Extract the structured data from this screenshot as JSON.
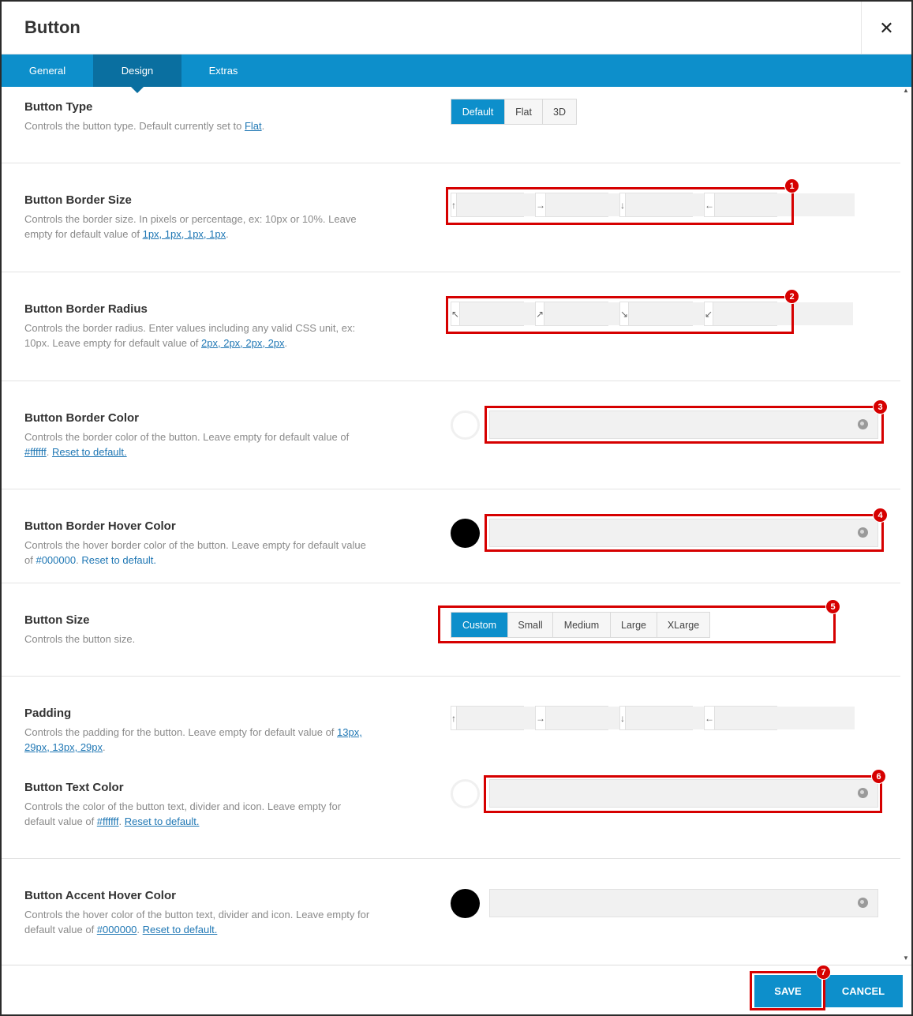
{
  "dialog": {
    "title": "Button"
  },
  "tabs": [
    {
      "label": "General"
    },
    {
      "label": "Design"
    },
    {
      "label": "Extras"
    }
  ],
  "settings": {
    "button_type": {
      "label": "Button Type",
      "desc_text": "Controls the button type. Default currently set to ",
      "desc_link": "Flat",
      "desc_end": ".",
      "options": [
        "Default",
        "Flat",
        "3D"
      ],
      "selected": "Default"
    },
    "border_size": {
      "label": "Button Border Size",
      "desc_text": "Controls the border size. In pixels or percentage, ex: 10px or 10%. Leave empty for default value of ",
      "desc_link": "1px, 1px, 1px, 1px",
      "desc_end": ".",
      "icons": [
        "↑",
        "→",
        "↓",
        "←"
      ]
    },
    "border_radius": {
      "label": "Button Border Radius",
      "desc_text": "Controls the border radius. Enter values including any valid CSS unit, ex: 10px. Leave empty for default value of ",
      "desc_link": "2px, 2px, 2px, 2px",
      "desc_end": ".",
      "icons": [
        "↖",
        "↗",
        "↘",
        "↙"
      ]
    },
    "border_color": {
      "label": "Button Border Color",
      "desc_text": "Controls the border color of the button. Leave empty for default value of ",
      "desc_link": "#ffffff",
      "desc_mid": ". ",
      "reset": "Reset to default.",
      "swatch": "#ffffff"
    },
    "border_hover_color": {
      "label": "Button Border Hover Color",
      "desc_text": "Controls the hover border color of the button. Leave empty for default value of ",
      "desc_link": "#000000",
      "desc_mid": ". ",
      "reset": "Reset to default.",
      "swatch": "#000000"
    },
    "button_size": {
      "label": "Button Size",
      "desc": "Controls the button size.",
      "options": [
        "Custom",
        "Small",
        "Medium",
        "Large",
        "XLarge"
      ],
      "selected": "Custom"
    },
    "padding": {
      "label": "Padding",
      "desc_text": "Controls the padding for the button. Leave empty for default value of ",
      "desc_link": "13px, 29px, 13px, 29px",
      "desc_end": ".",
      "icons": [
        "↑",
        "→",
        "↓",
        "←"
      ]
    },
    "text_color": {
      "label": "Button Text Color",
      "desc_text": "Controls the color of the button text, divider and icon. Leave empty for default value of ",
      "desc_link": "#ffffff",
      "desc_mid": ". ",
      "reset": "Reset to default.",
      "swatch": "#ffffff"
    },
    "accent_hover_color": {
      "label": "Button Accent Hover Color",
      "desc_text": "Controls the hover color of the button text, divider and icon. Leave empty for default value of ",
      "desc_link": "#000000",
      "desc_mid": ". ",
      "reset": "Reset to default.",
      "swatch": "#000000"
    }
  },
  "annotations": [
    "1",
    "2",
    "3",
    "4",
    "5",
    "6",
    "7"
  ],
  "footer": {
    "save": "SAVE",
    "cancel": "CANCEL"
  },
  "colors": {
    "accent": "#0d8fcb",
    "accent_dark": "#0a6fa0",
    "highlight": "#d60000"
  }
}
